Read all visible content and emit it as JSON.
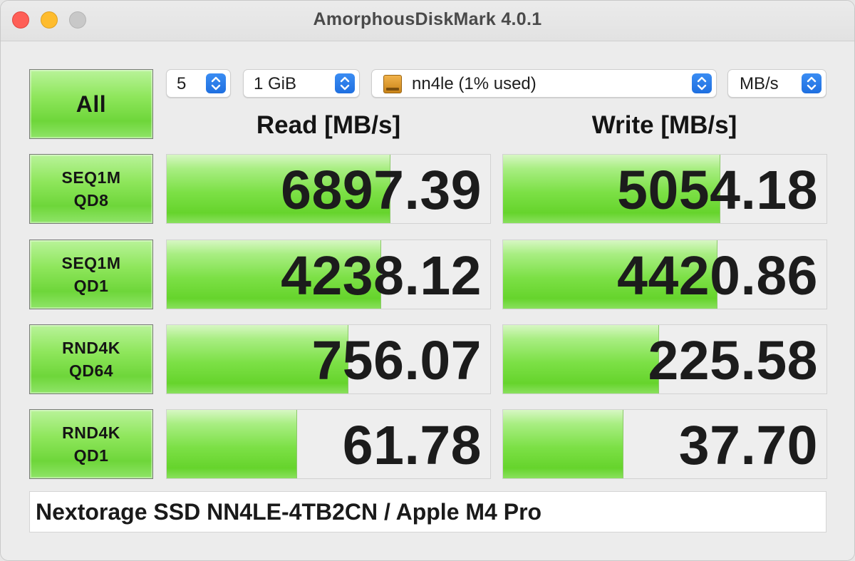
{
  "window": {
    "title": "AmorphousDiskMark 4.0.1"
  },
  "controls": {
    "all_label": "All",
    "count": "5",
    "size": "1 GiB",
    "drive": "nn4le (1% used)",
    "unit": "MB/s"
  },
  "headers": {
    "read": "Read [MB/s]",
    "write": "Write [MB/s]"
  },
  "tests": [
    {
      "line1": "SEQ1M",
      "line2": "QD8",
      "read": "6897.39",
      "write": "5054.18",
      "read_fill_pct": 69,
      "write_fill_pct": 67
    },
    {
      "line1": "SEQ1M",
      "line2": "QD1",
      "read": "4238.12",
      "write": "4420.86",
      "read_fill_pct": 66,
      "write_fill_pct": 66
    },
    {
      "line1": "RND4K",
      "line2": "QD64",
      "read": "756.07",
      "write": "225.58",
      "read_fill_pct": 56,
      "write_fill_pct": 48
    },
    {
      "line1": "RND4K",
      "line2": "QD1",
      "read": "61.78",
      "write": "37.70",
      "read_fill_pct": 40,
      "write_fill_pct": 37
    }
  ],
  "footer": {
    "comment": "Nextorage SSD NN4LE-4TB2CN / Apple M4 Pro"
  },
  "colors": {
    "accent": "#1e6fe0",
    "bar_green": "#66d42c"
  },
  "icons": {
    "drive": "external-drive-icon",
    "select": "chevron-up-down-icon"
  }
}
